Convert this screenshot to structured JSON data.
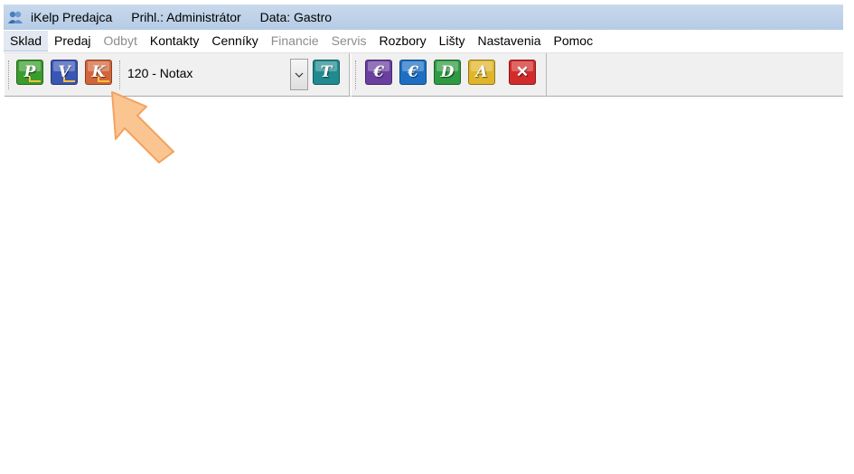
{
  "window": {
    "app_name": "iKelp Predajca",
    "user_label": "Prihl.: Administrátor",
    "data_label": "Data: Gastro"
  },
  "menu": [
    {
      "label": "Sklad",
      "state": "active"
    },
    {
      "label": "Predaj",
      "state": "normal"
    },
    {
      "label": "Odbyt",
      "state": "disabled"
    },
    {
      "label": "Kontakty",
      "state": "normal"
    },
    {
      "label": "Cenníky",
      "state": "normal"
    },
    {
      "label": "Financie",
      "state": "disabled"
    },
    {
      "label": "Servis",
      "state": "disabled"
    },
    {
      "label": "Rozbory",
      "state": "normal"
    },
    {
      "label": "Lišty",
      "state": "normal"
    },
    {
      "label": "Nastavenia",
      "state": "normal"
    },
    {
      "label": "Pomoc",
      "state": "normal"
    }
  ],
  "toolbar": {
    "buttons_left": [
      {
        "letter": "P",
        "icon": "prijem-icon",
        "color": "#3a9b2f"
      },
      {
        "letter": "V",
        "icon": "vydaj-icon",
        "color": "#3a56b5"
      },
      {
        "letter": "K",
        "icon": "kasa-icon",
        "color": "#d2653a"
      }
    ],
    "warehouse_select": {
      "value": "120 - Notax"
    },
    "button_t": {
      "letter": "T",
      "icon": "transfer-icon",
      "color": "#1f8a8f"
    },
    "buttons_right": [
      {
        "letter": "€",
        "icon": "euro-doc-icon",
        "color": "#6a3fa0"
      },
      {
        "letter": "€",
        "icon": "euro-card-icon",
        "color": "#1d6fc4"
      },
      {
        "letter": "D",
        "icon": "dodaci-list-icon",
        "color": "#2e9a42"
      },
      {
        "letter": "A",
        "icon": "objednavka-icon",
        "color": "#e0b52a"
      },
      {
        "letter": "✕",
        "icon": "close-icon",
        "color": "#d32a2a"
      }
    ]
  },
  "colors": {
    "titlebar": "#b5cbe5",
    "highlight_arrow": "#f9b87c"
  }
}
